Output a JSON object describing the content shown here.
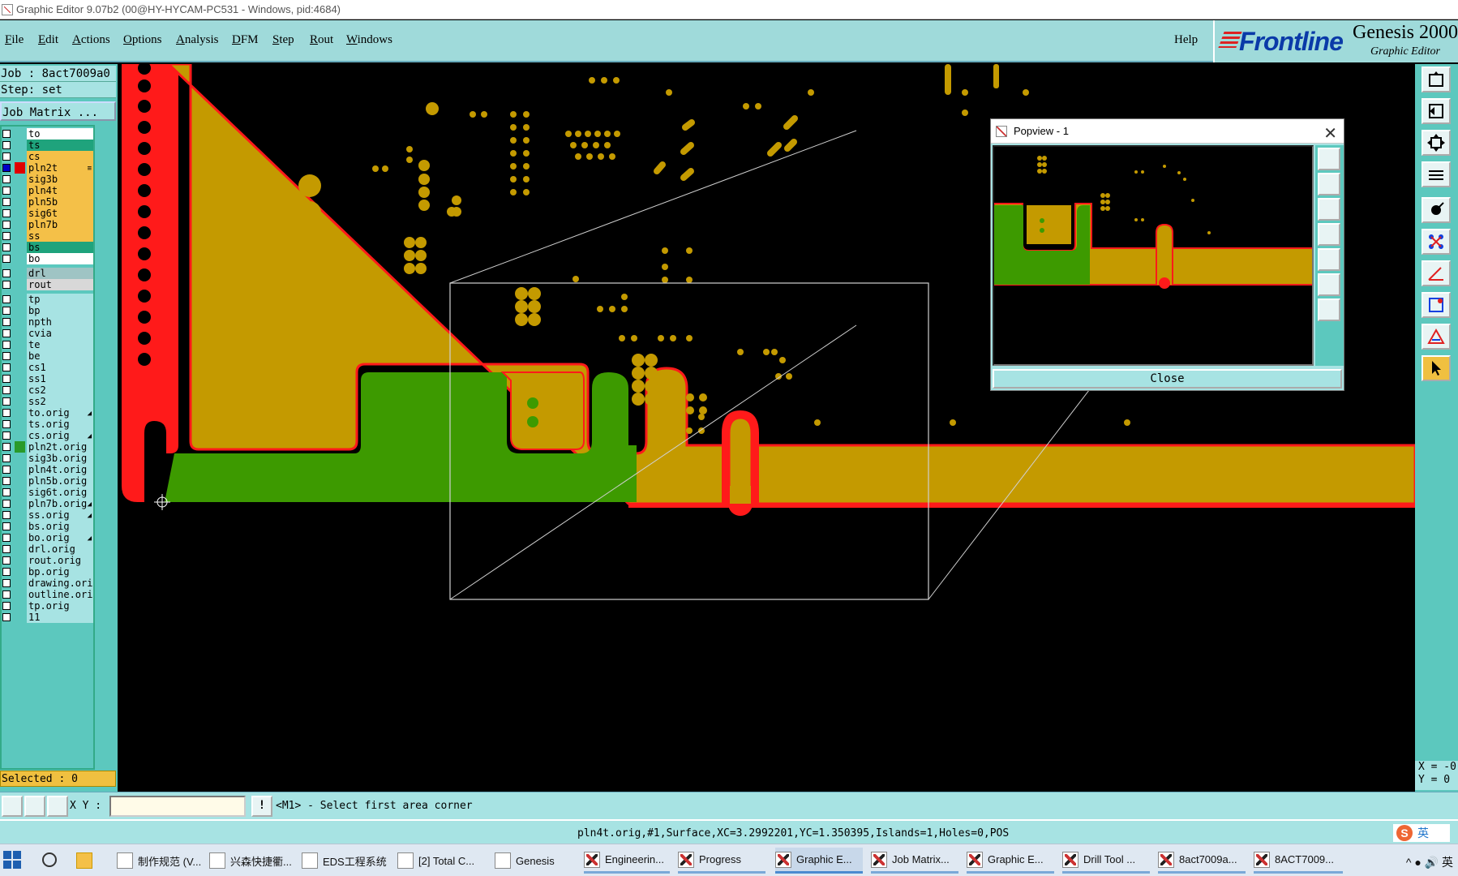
{
  "window": {
    "title": "Graphic Editor 9.07b2 (00@HY-HYCAM-PC531 - Windows, pid:4684)"
  },
  "menu": {
    "items": [
      "File",
      "Edit",
      "Actions",
      "Options",
      "Analysis",
      "DFM",
      "Step",
      "Rout",
      "Windows"
    ],
    "help": "Help"
  },
  "brand": {
    "logo": "Frontline",
    "product": "Genesis 2000",
    "subtitle": "Graphic Editor"
  },
  "job": {
    "job_line": "Job : 8act7009a0",
    "step_line": "Step: set",
    "matrix_button": "Job Matrix ..."
  },
  "layers": [
    {
      "name": "to",
      "color": "#ffffff"
    },
    {
      "name": "ts",
      "color": "#1fa37c"
    },
    {
      "name": "cs",
      "color": "#f4c048"
    },
    {
      "name": "pln2t",
      "color": "#f4c048",
      "active": true,
      "swatch": "#e00000",
      "mark": "≡"
    },
    {
      "name": "sig3b",
      "color": "#f4c048"
    },
    {
      "name": "pln4t",
      "color": "#f4c048"
    },
    {
      "name": "pln5b",
      "color": "#f4c048"
    },
    {
      "name": "sig6t",
      "color": "#f4c048"
    },
    {
      "name": "pln7b",
      "color": "#f4c048"
    },
    {
      "name": "ss",
      "color": "#f4c048"
    },
    {
      "name": "bs",
      "color": "#1fa37c"
    },
    {
      "name": "bo",
      "color": "#ffffff"
    },
    {
      "name": "drl",
      "color": "#9fc4c4",
      "gap": true
    },
    {
      "name": "rout",
      "color": "#d8d8d8"
    },
    {
      "name": "tp",
      "color": "#a7e3e3",
      "gap": true
    },
    {
      "name": "bp",
      "color": "#a7e3e3"
    },
    {
      "name": "npth",
      "color": "#a7e3e3"
    },
    {
      "name": "cvia",
      "color": "#a7e3e3"
    },
    {
      "name": "te",
      "color": "#a7e3e3"
    },
    {
      "name": "be",
      "color": "#a7e3e3"
    },
    {
      "name": "cs1",
      "color": "#a7e3e3"
    },
    {
      "name": "ss1",
      "color": "#a7e3e3"
    },
    {
      "name": "cs2",
      "color": "#a7e3e3"
    },
    {
      "name": "ss2",
      "color": "#a7e3e3"
    },
    {
      "name": "to.orig",
      "color": "#a7e3e3",
      "mark": "◢"
    },
    {
      "name": "ts.orig",
      "color": "#a7e3e3"
    },
    {
      "name": "cs.orig",
      "color": "#a7e3e3",
      "mark": "◢"
    },
    {
      "name": "pln2t.orig",
      "color": "#a7e3e3",
      "swatch": "#2a9a2a"
    },
    {
      "name": "sig3b.orig",
      "color": "#a7e3e3"
    },
    {
      "name": "pln4t.orig",
      "color": "#a7e3e3"
    },
    {
      "name": "pln5b.orig",
      "color": "#a7e3e3"
    },
    {
      "name": "sig6t.orig",
      "color": "#a7e3e3"
    },
    {
      "name": "pln7b.orig",
      "color": "#a7e3e3",
      "mark": "◢"
    },
    {
      "name": "ss.orig",
      "color": "#a7e3e3",
      "mark": "◢"
    },
    {
      "name": "bs.orig",
      "color": "#a7e3e3"
    },
    {
      "name": "bo.orig",
      "color": "#a7e3e3",
      "mark": "◢"
    },
    {
      "name": "drl.orig",
      "color": "#a7e3e3"
    },
    {
      "name": "rout.orig",
      "color": "#a7e3e3"
    },
    {
      "name": "bp.orig",
      "color": "#a7e3e3"
    },
    {
      "name": "drawing.orig",
      "color": "#a7e3e3"
    },
    {
      "name": "outline.orig",
      "color": "#a7e3e3"
    },
    {
      "name": "tp.orig",
      "color": "#a7e3e3"
    },
    {
      "name": "11",
      "color": "#a7e3e3"
    }
  ],
  "selected": "Selected : 0",
  "command": {
    "xy_label": "X Y :",
    "xy_value": "",
    "prompt": "<M1> - Select first area corner",
    "bang": "!"
  },
  "status": "pln4t.orig,#1,Surface,XC=3.2992201,YC=1.350395,Islands=1,Holes=0,POS",
  "xy_readout": {
    "x": "X = -0",
    "y": "Y = 0"
  },
  "popview": {
    "title": "Popview - 1",
    "close_x": "✕",
    "close_button": "Close"
  },
  "ime": {
    "icon": "S",
    "lang": "英"
  },
  "taskbar": {
    "items": [
      {
        "label": "制作规范 (V...",
        "icon": "doc"
      },
      {
        "label": "兴森快捷衢...",
        "icon": "brain"
      },
      {
        "label": "EDS工程系统",
        "icon": "eds"
      },
      {
        "label": "[2] Total C...",
        "icon": "save"
      },
      {
        "label": "Genesis",
        "icon": "genesis"
      },
      {
        "label": "Engineerin...",
        "icon": "x"
      },
      {
        "label": "Progress",
        "icon": "x"
      },
      {
        "label": "Graphic E...",
        "icon": "x",
        "active": true
      },
      {
        "label": "Job Matrix...",
        "icon": "x"
      },
      {
        "label": "Graphic E...",
        "icon": "x"
      },
      {
        "label": "Drill Tool ...",
        "icon": "x"
      },
      {
        "label": "8act7009a...",
        "icon": "x"
      },
      {
        "label": "8ACT7009...",
        "icon": "x"
      }
    ],
    "tray": "^ ● 🔊 英"
  },
  "colors": {
    "copper": "#c49a00",
    "outline_red": "#ff1a1a",
    "plane_green": "#3d9a00",
    "panel": "#5cc8be",
    "panel_light": "#a7e3e3",
    "highlight": "#f0c040"
  }
}
